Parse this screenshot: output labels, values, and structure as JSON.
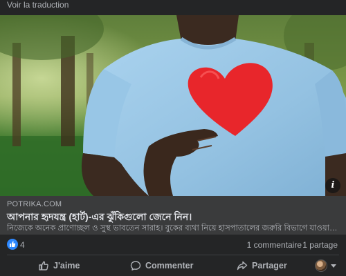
{
  "post": {
    "translate_label": "Voir la traduction",
    "info_icon_glyph": "i"
  },
  "link_preview": {
    "domain": "POTRIKA.COM",
    "title": "আপনার হৃদযন্ত্র (হার্ট)-এর ঝুঁকিগুলো জেনে নিন।",
    "description": "নিজেকে অনেক প্রাণোচ্ছল ও সুস্থ ভাবতেন সারাহ। বুকের ব্যথা নিয়ে হাসপাতালের জরুরি বিভাগে যাওয়ার আগ..."
  },
  "stats": {
    "reaction_count": "4",
    "comments": "1 commentaire",
    "shares": "1 partage"
  },
  "actions": {
    "like_label": "J'aime",
    "comment_label": "Commenter",
    "share_label": "Partager"
  },
  "colors": {
    "background": "#242526",
    "preview_background": "#3a3b3c",
    "text_primary": "#e4e6eb",
    "text_secondary": "#b0b3b8",
    "like_blue": "#2d88ff",
    "heart_red": "#ea2b2b",
    "shirt_blue": "#9fcbe8"
  },
  "icons": {
    "reaction": "like-icon",
    "like": "thumbs-up-icon",
    "comment": "comment-bubble-icon",
    "share": "share-arrow-icon",
    "info": "info-icon",
    "audience": "caret-down-icon"
  }
}
